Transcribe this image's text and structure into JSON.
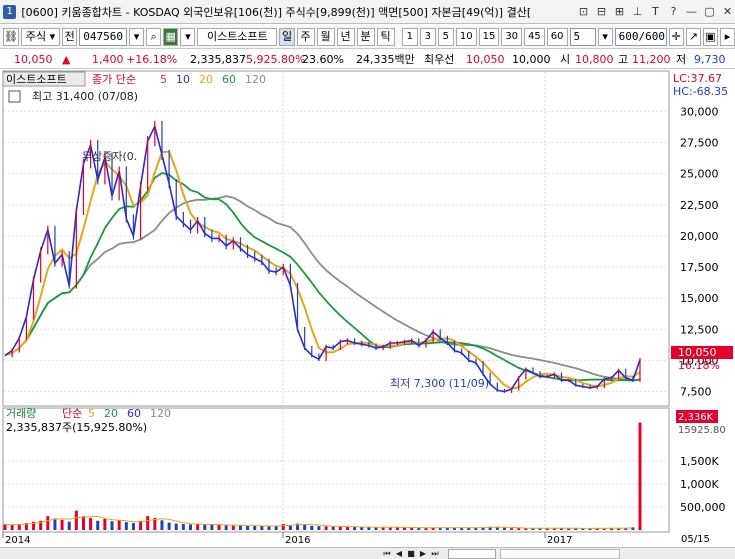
{
  "window": {
    "number": "1",
    "title": "[0600] 키움종합차트 - KOSDAQ 외국인보유[106(천)] 주식수[9,899(천)] 액면[500] 자본금[49(억)] 결산[",
    "icons": [
      "restore-icon",
      "tile-icon",
      "cascade-icon",
      "pin-icon",
      "text-icon",
      "help-icon",
      "minimize-icon",
      "maximize-icon",
      "close-icon"
    ],
    "icon_glyphs": [
      "⊡",
      "⊟",
      "⊞",
      "⊥",
      "T",
      "?",
      "—",
      "▢",
      "✕"
    ]
  },
  "toolbar": {
    "market": "주식",
    "prev": "전",
    "code": "047560",
    "stock_name": "이스트소프트",
    "il": "일",
    "periods": [
      "주",
      "월",
      "년",
      "분",
      "틱"
    ],
    "intervals": [
      "1",
      "3",
      "5",
      "10",
      "15",
      "30",
      "45",
      "60"
    ],
    "interval_value": "5",
    "count": "600/600"
  },
  "quote": {
    "price": "10,050",
    "arrow": "▲",
    "change": "1,400",
    "change_pct": "+16.18%",
    "volume": "2,335,837",
    "volume_pct": "5,925.80%",
    "turnover": "23.60%",
    "amount": "24,335백만",
    "best_label": "최우선",
    "best_ask": "10,050",
    "best_bid": "10,000",
    "open_label": "시",
    "open": "10,800",
    "high_label": "고",
    "high": "11,200",
    "low_label": "저",
    "low": "9,730"
  },
  "price_panel": {
    "legend_name": "이스트소프트",
    "legend_ma": "종가 단순",
    "ma_periods": [
      "5",
      "10",
      "20",
      "60",
      "120"
    ],
    "ma_colors": [
      "#e8311a",
      "#2a2ad0",
      "#e8a51e",
      "#1a9a3a",
      "#8c8c8c"
    ],
    "high_note": "최고 31,400 (07/08)",
    "mid_note": "무상증자(0.",
    "low_note": "최저 7,300 (11/09)",
    "lc": "LC:37.67",
    "hc": "HC:-68.35",
    "current_tag": "10,050",
    "current_pct": "16.18%",
    "y_ticks": [
      "30,000",
      "27,500",
      "25,000",
      "22,500",
      "20,000",
      "17,500",
      "15,000",
      "12,500",
      "10,000",
      "7,500"
    ]
  },
  "volume_panel": {
    "legend": "거래량",
    "legend_ma": "단순",
    "ma_periods": [
      "5",
      "20",
      "60",
      "120"
    ],
    "value_text": "2,335,837주(15,925.80%)",
    "tag_value": "2,336K",
    "tag_pct": "15925.80",
    "y_ticks": [
      "1,500K",
      "1,000K",
      "500,000"
    ]
  },
  "x_axis": {
    "labels": [
      "2014",
      "2016",
      "2017"
    ],
    "date": "05/15"
  },
  "colors": {
    "up": "#e4002b",
    "down": "#1f3fbf",
    "tag_bg": "#e4002b"
  },
  "chart_data": {
    "type": "line",
    "title": "",
    "series": [
      {
        "name": "",
        "y": [
          10400,
          10800,
          11800,
          13500,
          16500,
          18800,
          20500,
          17800,
          18500,
          16000,
          22000,
          25800,
          27300,
          24500,
          26300,
          23200,
          25200,
          21400,
          20000,
          24000,
          27600,
          28800,
          26500,
          24200,
          21600,
          21000,
          20500,
          21200,
          20200,
          19800,
          19800,
          19200,
          19600,
          19000,
          18500,
          18200,
          17900,
          17200,
          17100,
          17500,
          16000,
          12500,
          11000,
          10400,
          10100,
          11100,
          11000,
          11500,
          11600,
          11400,
          11300,
          11200,
          11000,
          11100,
          11400,
          11400,
          11500,
          11600,
          11200,
          11600,
          12300,
          11800,
          11400,
          10800,
          10600,
          10000,
          9800,
          8900,
          8100,
          7600,
          7500,
          7700,
          8600,
          9300,
          9000,
          8700,
          8700,
          8900,
          8400,
          8400,
          8000,
          7900,
          7800,
          7900,
          8500,
          8600,
          9200,
          8600,
          8400,
          10050
        ]
      }
    ],
    "volume": [
      120,
      110,
      130,
      150,
      180,
      200,
      300,
      250,
      220,
      180,
      420,
      300,
      260,
      200,
      240,
      190,
      210,
      170,
      150,
      200,
      300,
      260,
      210,
      160,
      140,
      130,
      120,
      130,
      120,
      110,
      110,
      100,
      100,
      95,
      90,
      95,
      85,
      80,
      90,
      130,
      100,
      140,
      120,
      90,
      85,
      80,
      75,
      70,
      70,
      65,
      60,
      55,
      60,
      58,
      60,
      55,
      52,
      50,
      48,
      48,
      52,
      50,
      48,
      46,
      45,
      50,
      55,
      60,
      70,
      65,
      50,
      40,
      40,
      38,
      40,
      38,
      36,
      38,
      36,
      36,
      34,
      36,
      35,
      34,
      38,
      40,
      45,
      40,
      60,
      2336
    ],
    "ylim": [
      6500,
      33000
    ]
  }
}
